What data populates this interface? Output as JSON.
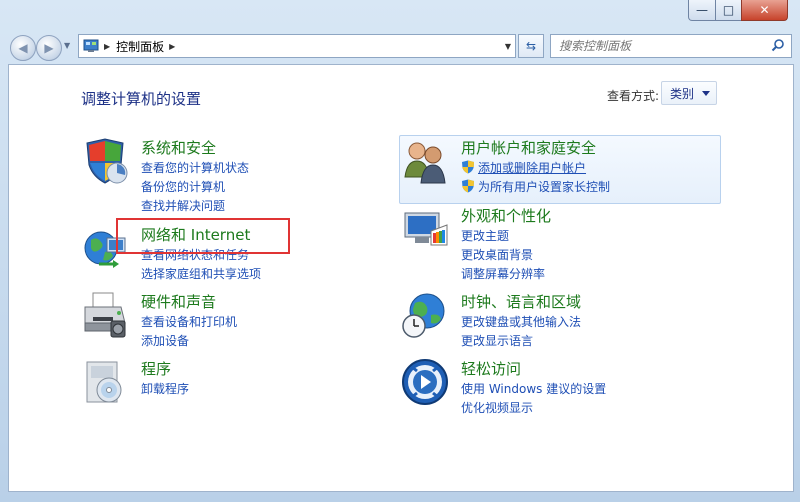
{
  "window": {
    "minimize_label": "—",
    "maximize_label": "□",
    "close_label": "✕"
  },
  "nav": {
    "breadcrumb": "控制面板",
    "search_placeholder": "搜索控制面板"
  },
  "header": {
    "title": "调整计算机的设置",
    "view_by_label": "查看方式:",
    "view_by_value": "类别"
  },
  "categories": [
    {
      "title": "系统和安全",
      "links": [
        "查看您的计算机状态",
        "备份您的计算机",
        "查找并解决问题"
      ]
    },
    {
      "title": "网络和 Internet",
      "links": [
        "查看网络状态和任务",
        "选择家庭组和共享选项"
      ]
    },
    {
      "title": "硬件和声音",
      "links": [
        "查看设备和打印机",
        "添加设备"
      ]
    },
    {
      "title": "程序",
      "links": [
        "卸载程序"
      ]
    },
    {
      "title": "用户帐户和家庭安全",
      "links": [
        "添加或删除用户帐户",
        "为所有用户设置家长控制"
      ]
    },
    {
      "title": "外观和个性化",
      "links": [
        "更改主题",
        "更改桌面背景",
        "调整屏幕分辨率"
      ]
    },
    {
      "title": "时钟、语言和区域",
      "links": [
        "更改键盘或其他输入法",
        "更改显示语言"
      ]
    },
    {
      "title": "轻松访问",
      "links": [
        "使用 Windows 建议的设置",
        "优化视频显示"
      ]
    }
  ],
  "colors": {
    "category_title": "#1d7a1d",
    "link": "#1f4fb5",
    "page_title": "#1e3287",
    "highlight_box": "#e03434"
  }
}
